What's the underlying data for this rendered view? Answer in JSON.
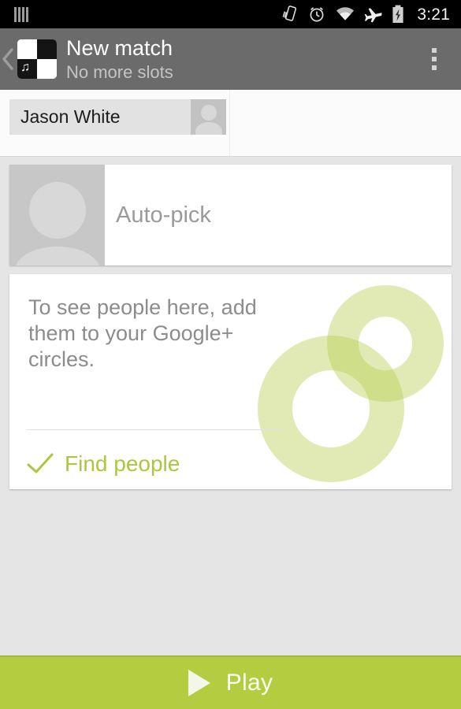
{
  "status_bar": {
    "time": "3:21",
    "icons": [
      "sim-card-icon",
      "vibrate-icon",
      "alarm-clock-icon",
      "wifi-icon",
      "airplane-mode-icon",
      "battery-charging-icon"
    ]
  },
  "action_bar": {
    "back_label": "back-chevron",
    "app_icon": "checkered-music-note-icon",
    "title": "New match",
    "subtitle": "No more slots",
    "overflow_label": "overflow-menu"
  },
  "recipients": {
    "chips": [
      {
        "name": "Jason White",
        "avatar": "person-placeholder-icon"
      }
    ]
  },
  "auto_pick": {
    "label": "Auto-pick",
    "avatar": "person-placeholder-icon"
  },
  "empty_state": {
    "message": "To see people here, add them to your Google+ circles.",
    "action_label": "Find people",
    "action_icon": "check-icon",
    "artwork": "two-overlapping-circles"
  },
  "play_bar": {
    "label": "Play",
    "icon": "play-triangle-icon"
  },
  "colors": {
    "accent_green": "#b3cc40",
    "action_green": "#aac73f",
    "action_bar": "#6b6b6b",
    "status_bar": "#000000",
    "page_background": "#e5e5e5",
    "card_background": "#ffffff",
    "muted_text": "#8c8c8c"
  }
}
